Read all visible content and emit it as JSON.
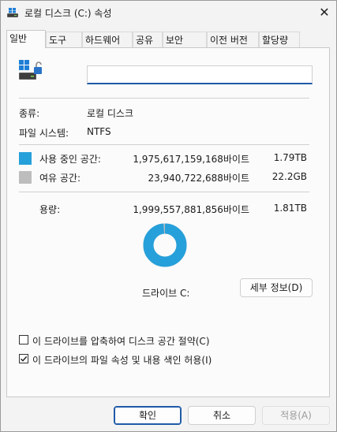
{
  "window": {
    "title": "로컬 디스크 (C:) 속성",
    "close_glyph": "✕"
  },
  "tabs": [
    "일반",
    "도구",
    "하드웨어",
    "공유",
    "보안",
    "이전 버전",
    "할당량"
  ],
  "general": {
    "volume_name_value": "",
    "type_label": "종류:",
    "type_value": "로컬 디스크",
    "fs_label": "파일 시스템:",
    "fs_value": "NTFS",
    "used": {
      "label": "사용 중인 공간:",
      "bytes": "1,975,617,159,168바이트",
      "short": "1.79TB",
      "color": "#26a0da",
      "fraction": 0.988
    },
    "free": {
      "label": "여유 공간:",
      "bytes": "23,940,722,688바이트",
      "short": "22.2GB",
      "color": "#bdbdbd"
    },
    "capacity": {
      "label": "용량:",
      "bytes": "1,999,557,881,856바이트",
      "short": "1.81TB"
    },
    "drive_label": "드라이브 C:",
    "details_button": "세부 정보(D)",
    "compress_option": {
      "label": "이 드라이브를 압축하여 디스크 공간 절약(C)",
      "checked": false
    },
    "index_option": {
      "label": "이 드라이브의 파일 속성 및 내용 색인 허용(I)",
      "checked": true
    }
  },
  "footer": {
    "ok": "확인",
    "cancel": "취소",
    "apply": "적용(A)"
  },
  "icons": {
    "title_icon": "drive-icon",
    "header_icon": "drive-unlocked-icon"
  }
}
